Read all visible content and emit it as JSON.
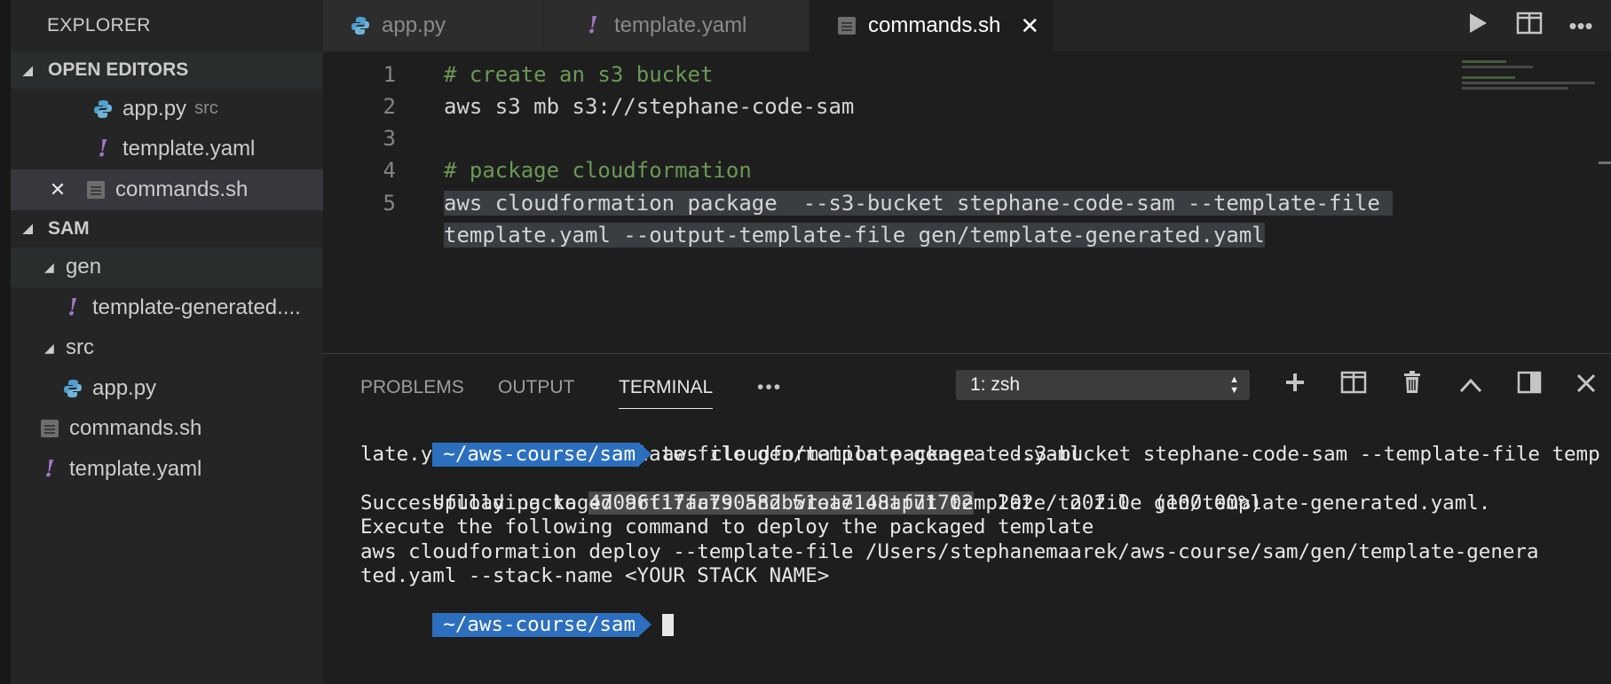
{
  "sidebar": {
    "title": "EXPLORER",
    "open_editors": {
      "label": "OPEN EDITORS",
      "items": [
        {
          "name": "app.py",
          "sub": "src"
        },
        {
          "name": "template.yaml"
        },
        {
          "name": "commands.sh"
        }
      ]
    },
    "project": {
      "label": "SAM",
      "gen_folder": "gen",
      "gen_file": "template-generated....",
      "src_folder": "src",
      "src_file": "app.py",
      "commands": "commands.sh",
      "template": "template.yaml"
    }
  },
  "tabs": [
    {
      "label": "app.py",
      "icon": "python-icon"
    },
    {
      "label": "template.yaml",
      "icon": "yaml-icon"
    },
    {
      "label": "commands.sh",
      "icon": "shell-file-icon",
      "active": true
    }
  ],
  "editor": {
    "lines": [
      {
        "num": "1",
        "text": "# create an s3 bucket"
      },
      {
        "num": "2",
        "text": "aws s3 mb s3://stephane-code-sam"
      },
      {
        "num": "3",
        "text": ""
      },
      {
        "num": "4",
        "text": "# package cloudformation"
      },
      {
        "num": "5",
        "text": "aws cloudformation package  --s3-bucket stephane-code-sam --template-file "
      },
      {
        "num": "",
        "text": "template.yaml --output-template-file gen/template-generated.yaml"
      }
    ]
  },
  "panel": {
    "tabs": [
      "PROBLEMS",
      "OUTPUT",
      "TERMINAL"
    ],
    "more": "•••",
    "terminal_select": "1: zsh"
  },
  "terminal": {
    "prompt": "~/aws-course/sam",
    "command_1": "aws cloudformation package  --s3-bucket stephane-code-sam --template-file temp",
    "command_2": "late.yaml --output-template-file gen/template-generated.yaml",
    "upload_prefix": "Uploading to ",
    "upload_hash": "47096f17fa790582b51ea7148af71702",
    "upload_progress": "  202 / 202.0  (100.00%)",
    "line_success": "Successfully packaged artifacts and wrote output template to file gen/template-generated.yaml.",
    "line_execute": "Execute the following command to deploy the packaged template",
    "line_deploy_1": "aws cloudformation deploy --template-file /Users/stephanemaarek/aws-course/sam/gen/template-genera",
    "line_deploy_2": "ted.yaml --stack-name <YOUR STACK NAME>"
  },
  "colors": {
    "accent_prompt": "#2d6fbf",
    "comment": "#6a9955",
    "yaml_icon": "#a074c4",
    "python_icon": "#4f9fcf"
  }
}
